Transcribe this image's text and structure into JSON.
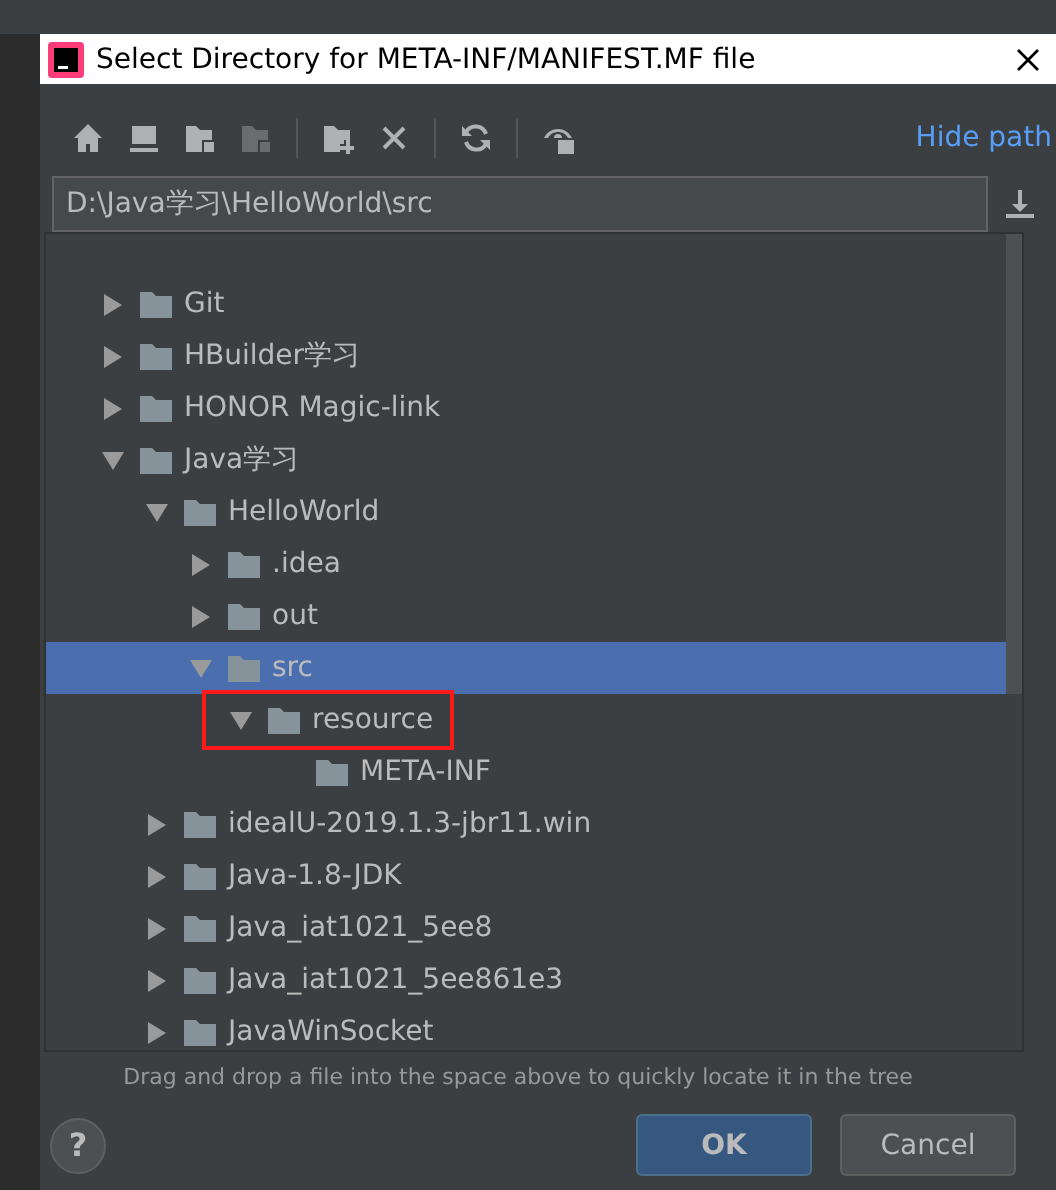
{
  "window": {
    "title": "Select Directory for META-INF/MANIFEST.MF file"
  },
  "toolbar": {
    "hide_path_link": "Hide path"
  },
  "path_field": {
    "value": "D:\\Java学习\\HelloWorld\\src"
  },
  "tree": [
    {
      "label": "Git",
      "expanded": false,
      "selected": false,
      "highlighted": false
    },
    {
      "label": "HBuilder学习",
      "expanded": false,
      "selected": false,
      "highlighted": false
    },
    {
      "label": "HONOR Magic-link",
      "expanded": false,
      "selected": false,
      "highlighted": false
    },
    {
      "label": "Java学习",
      "expanded": true,
      "selected": false,
      "highlighted": false,
      "children": [
        {
          "label": "HelloWorld",
          "expanded": true,
          "selected": false,
          "highlighted": false,
          "children": [
            {
              "label": ".idea",
              "expanded": false,
              "selected": false,
              "highlighted": false
            },
            {
              "label": "out",
              "expanded": false,
              "selected": false,
              "highlighted": false
            },
            {
              "label": "src",
              "expanded": true,
              "selected": true,
              "highlighted": false,
              "children": [
                {
                  "label": "resource",
                  "expanded": true,
                  "selected": false,
                  "highlighted": true,
                  "children": [
                    {
                      "label": "META-INF",
                      "selected": false,
                      "highlighted": false
                    }
                  ]
                }
              ]
            }
          ]
        },
        {
          "label": "idealU-2019.1.3-jbr11.win",
          "expanded": false,
          "selected": false,
          "highlighted": false
        },
        {
          "label": "Java-1.8-JDK",
          "expanded": false,
          "selected": false,
          "highlighted": false
        },
        {
          "label": "Java_iat1021_5ee8",
          "expanded": false,
          "selected": false,
          "highlighted": false
        },
        {
          "label": "Java_iat1021_5ee861e3",
          "expanded": false,
          "selected": false,
          "highlighted": false
        },
        {
          "label": "JavaWinSocket",
          "expanded": false,
          "selected": false,
          "highlighted": false
        }
      ]
    }
  ],
  "hint": "Drag and drop a file into the space above to quickly locate it in the tree",
  "buttons": {
    "help": "?",
    "ok": "OK",
    "cancel": "Cancel"
  }
}
